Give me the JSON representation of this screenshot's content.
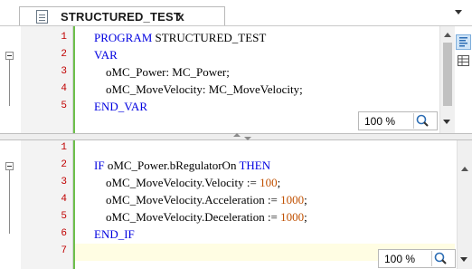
{
  "tab": {
    "title": "STRUCTURED_TEST",
    "close_glyph": "x",
    "icon": "document-icon"
  },
  "top_pane": {
    "lines": [
      {
        "n": "1",
        "segments": [
          {
            "t": "PROGRAM",
            "k": "kw"
          },
          {
            "t": " STRUCTURED_TEST",
            "k": ""
          }
        ]
      },
      {
        "n": "2",
        "segments": [
          {
            "t": "VAR",
            "k": "kw"
          }
        ]
      },
      {
        "n": "3",
        "segments": [
          {
            "t": "    oMC_Power: MC_Power;",
            "k": ""
          }
        ]
      },
      {
        "n": "4",
        "segments": [
          {
            "t": "    oMC_MoveVelocity: MC_MoveVelocity;",
            "k": ""
          }
        ]
      },
      {
        "n": "5",
        "segments": [
          {
            "t": "END_VAR",
            "k": "kw"
          }
        ]
      }
    ],
    "zoom": "100 %"
  },
  "bottom_pane": {
    "lines": [
      {
        "n": "1",
        "segments": []
      },
      {
        "n": "2",
        "segments": [
          {
            "t": "IF",
            "k": "kw"
          },
          {
            "t": " oMC_Power.bRegulatorOn ",
            "k": ""
          },
          {
            "t": "THEN",
            "k": "kw"
          }
        ]
      },
      {
        "n": "3",
        "segments": [
          {
            "t": "    oMC_MoveVelocity.Velocity := ",
            "k": ""
          },
          {
            "t": "100",
            "k": "num"
          },
          {
            "t": ";",
            "k": ""
          }
        ]
      },
      {
        "n": "4",
        "segments": [
          {
            "t": "    oMC_MoveVelocity.Acceleration := ",
            "k": ""
          },
          {
            "t": "1000",
            "k": "num"
          },
          {
            "t": ";",
            "k": ""
          }
        ]
      },
      {
        "n": "5",
        "segments": [
          {
            "t": "    oMC_MoveVelocity.Deceleration := ",
            "k": ""
          },
          {
            "t": "1000",
            "k": "num"
          },
          {
            "t": ";",
            "k": ""
          }
        ]
      },
      {
        "n": "6",
        "segments": [
          {
            "t": "END_IF",
            "k": "kw"
          }
        ]
      },
      {
        "n": "7",
        "segments": []
      }
    ],
    "zoom": "100 %"
  },
  "colors": {
    "keyword": "#0000e0",
    "number": "#c05000",
    "line_number": "#c00000",
    "current_line": "#fffde3"
  }
}
